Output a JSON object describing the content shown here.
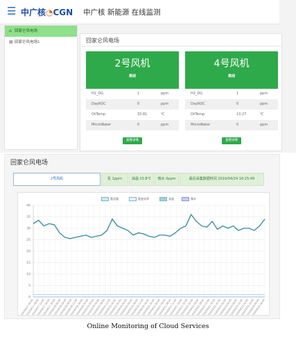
{
  "header": {
    "menu_icon": "hamburger-icon",
    "logo_text_cn": "中广核",
    "logo_text_en": "CGN",
    "title": "中广核 新能源 在线监测"
  },
  "sidebar": {
    "items": [
      {
        "label": "回家仑风电场",
        "icon": "home-icon",
        "active": true
      },
      {
        "label": "回家仑风电场1",
        "icon": "document-icon",
        "active": false
      }
    ]
  },
  "overview": {
    "title": "回家仑风电场",
    "cards": [
      {
        "name": "2号风机",
        "status": "离线",
        "rows": [
          {
            "key": "H2_DG",
            "value": "1",
            "unit": "ppm"
          },
          {
            "key": "DayROC",
            "value": "0",
            "unit": "ppm"
          },
          {
            "key": "OilTemp",
            "value": "33.81",
            "unit": "℃"
          },
          {
            "key": "MicroWater",
            "value": "0",
            "unit": "ppm"
          }
        ],
        "button": "查看详情"
      },
      {
        "name": "4号风机",
        "status": "离线",
        "rows": [
          {
            "key": "H2_DG",
            "value": "1",
            "unit": "ppm"
          },
          {
            "key": "DayROC",
            "value": "0",
            "unit": "ppm"
          },
          {
            "key": "OilTemp",
            "value": "13.27",
            "unit": "℃"
          },
          {
            "key": "MicroWater",
            "value": "0",
            "unit": "ppm"
          }
        ],
        "button": "查看详情"
      }
    ]
  },
  "detail": {
    "title": "回家仑风电场",
    "tabs": [
      {
        "label": "2号风机"
      },
      {
        "label": "氢 1ppm"
      },
      {
        "label": "油温 33.8℃"
      },
      {
        "label": "微水 0ppm"
      },
      {
        "label": "最近采集数据时间 2019/04/24 16:15:49"
      }
    ]
  },
  "chart_data": {
    "type": "line",
    "legend": [
      "氢含量",
      "氢变化率",
      "油温",
      "微水"
    ],
    "ylim": [
      0,
      40
    ],
    "yticks": [
      0,
      5,
      10,
      15,
      20,
      25,
      30,
      35,
      40
    ],
    "grid": true,
    "x": [
      "2019/04/17 04:00",
      "2019/04/17 08:00",
      "2019/04/17 12:00",
      "2019/04/17 16:00",
      "2019/04/17 20:00",
      "2019/04/18 00:00",
      "2019/04/18 04:00",
      "2019/04/18 08:00",
      "2019/04/18 12:00",
      "2019/04/18 16:00",
      "2019/04/18 20:00",
      "2019/04/19 00:00",
      "2019/04/19 04:00",
      "2019/04/19 08:00",
      "2019/04/19 12:00",
      "2019/04/19 16:00",
      "2019/04/19 20:00",
      "2019/04/20 00:00",
      "2019/04/20 04:00",
      "2019/04/20 08:00",
      "2019/04/20 12:00",
      "2019/04/20 16:00",
      "2019/04/20 20:00",
      "2019/04/21 00:00",
      "2019/04/21 04:00",
      "2019/04/21 08:00",
      "2019/04/21 12:00",
      "2019/04/21 16:00",
      "2019/04/21 20:00",
      "2019/04/22 00:00",
      "2019/04/22 04:00",
      "2019/04/22 08:00",
      "2019/04/22 12:00",
      "2019/04/22 16:00",
      "2019/04/22 20:00",
      "2019/04/23 00:00",
      "2019/04/23 04:00",
      "2019/04/23 08:00",
      "2019/04/23 12:00",
      "2019/04/23 16:00",
      "2019/04/23 20:00",
      "2019/04/24 00:00",
      "2019/04/24 16:00"
    ],
    "series": [
      {
        "name": "油温",
        "color": "#2f8a9e",
        "values": [
          32,
          33.5,
          31,
          32,
          31.5,
          28,
          26,
          25.5,
          26,
          26.5,
          27,
          26,
          26.5,
          27,
          29,
          34,
          31,
          30,
          29,
          27,
          28,
          27.5,
          26.5,
          26,
          27,
          27,
          26.5,
          28,
          30,
          31,
          36,
          33,
          31,
          30.5,
          33,
          29.5,
          31,
          30,
          31,
          29,
          30,
          30,
          29,
          31,
          34
        ]
      },
      {
        "name": "氢含量",
        "color": "#8fd3e0",
        "values": [
          1,
          1,
          1,
          1,
          1,
          1,
          1,
          1,
          1,
          1,
          1,
          1,
          1,
          1,
          1,
          1,
          1,
          1,
          1,
          1,
          1,
          1,
          1,
          1,
          1,
          1,
          1,
          1,
          1,
          1,
          1,
          1,
          1,
          1,
          1,
          1,
          1,
          1,
          1,
          1,
          1,
          1,
          1,
          1,
          1
        ]
      },
      {
        "name": "氢变化率",
        "color": "#b9e3ec",
        "values": [
          0,
          0,
          0,
          0,
          0,
          0,
          0,
          0,
          0,
          0,
          0,
          0,
          0,
          0,
          0,
          0,
          0,
          0,
          0,
          0,
          0,
          0,
          0,
          0,
          0,
          0,
          0,
          0,
          0,
          0,
          0,
          0,
          0,
          0,
          0,
          0,
          0,
          0,
          0,
          0,
          0,
          0,
          0,
          0,
          0
        ]
      },
      {
        "name": "微水",
        "color": "#aab3e6",
        "values": [
          0,
          0,
          0,
          0,
          0,
          0,
          0,
          0,
          0,
          0,
          0,
          0,
          0,
          0,
          0,
          0,
          0,
          0,
          0,
          0,
          0,
          0,
          0,
          0,
          0,
          0,
          0,
          0,
          0,
          0,
          0,
          0,
          0,
          0,
          0,
          0,
          0,
          0,
          0,
          0,
          0,
          0,
          0,
          0,
          0
        ]
      }
    ]
  },
  "caption": "Online Monitoring of Cloud Services"
}
